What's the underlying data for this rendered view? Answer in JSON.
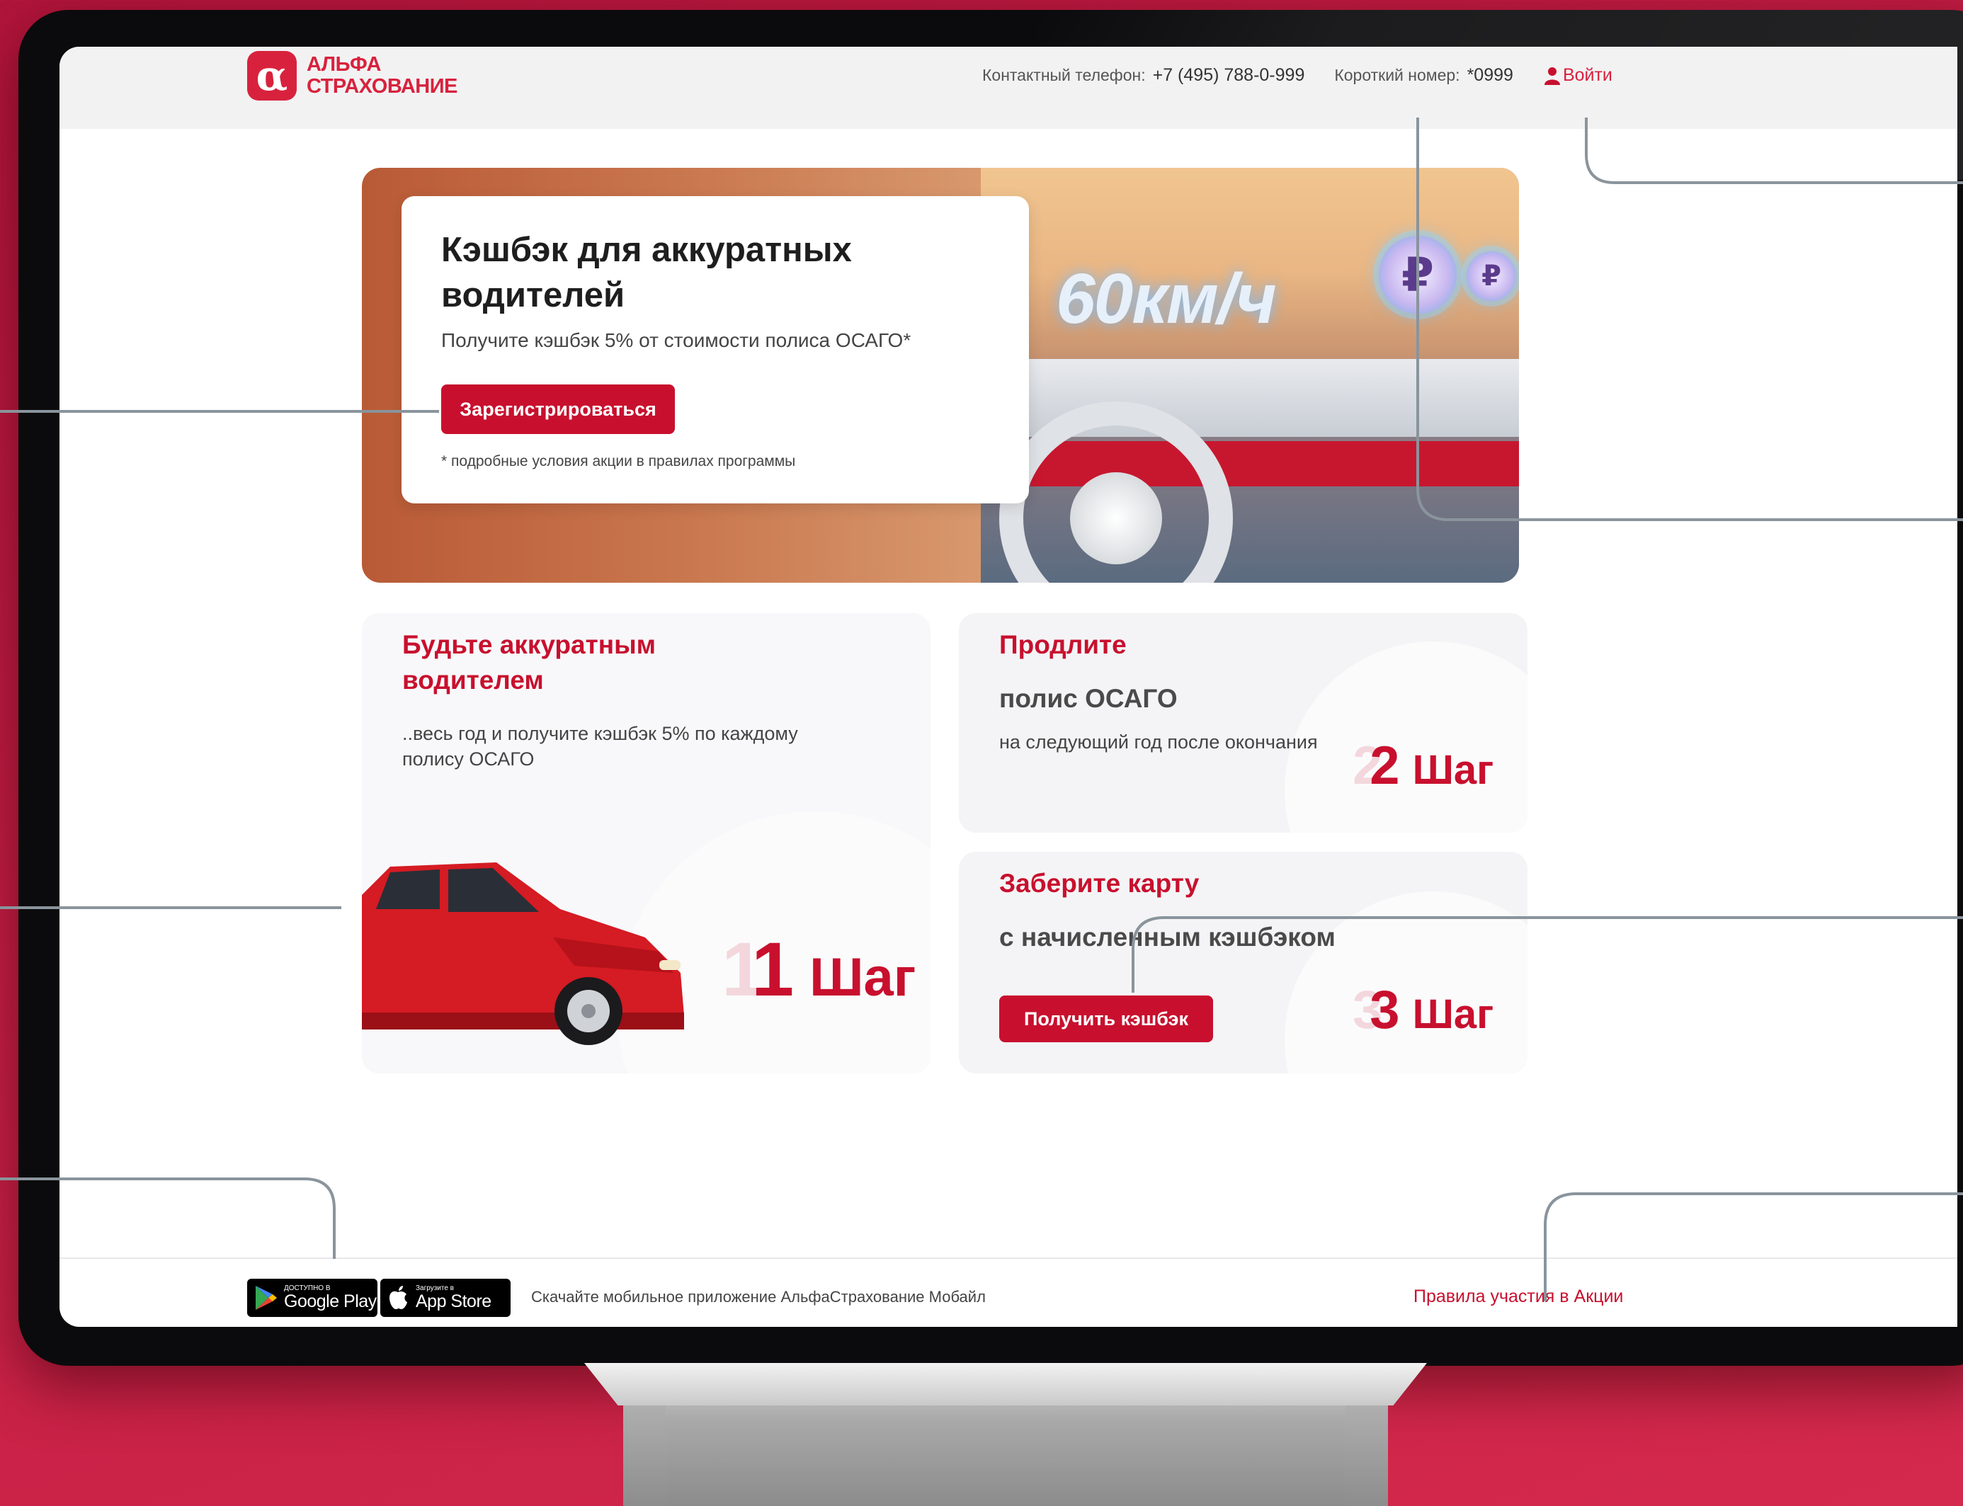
{
  "brand": {
    "name_line1": "АЛЬФА",
    "name_line2": "СТРАХОВАНИЕ",
    "logo_symbol": "α",
    "accent_color": "#c8102e"
  },
  "header": {
    "phone_label": "Контактный телефон:",
    "phone_value": "+7 (495) 788-0-999",
    "short_label": "Короткий номер:",
    "short_value": "*0999",
    "login_label": "Войти",
    "login_icon": "user-icon"
  },
  "hero": {
    "title": "Кэшбэк для аккуратных водителей",
    "subtitle": "Получите кэшбэк 5% от стоимости полиса ОСАГО*",
    "register_button": "Зарегистрироваться",
    "note": "* подробные условия акции в правилах программы",
    "speed_text": "60км/ч",
    "coin_symbol": "₽"
  },
  "steps": [
    {
      "title": "Будьте аккуратным водителем",
      "text": "..весь год и получите кэшбэк 5% по каждому полису ОСАГО",
      "number": "1",
      "word": "Шаг"
    },
    {
      "title": "Продлите",
      "subtitle": "полис ОСАГО",
      "text": "на следующий год после окончания",
      "number": "2",
      "word": "Шаг"
    },
    {
      "title": "Заберите карту",
      "subtitle": "с начисленным кэшбэком",
      "button": "Получить кэшбэк",
      "number": "3",
      "word": "Шаг"
    }
  ],
  "footer": {
    "google_play_small": "ДОСТУПНО В",
    "google_play_big": "Google Play",
    "app_store_small": "Загрузите в",
    "app_store_big": "App Store",
    "download_text": "Скачайте мобильное приложение АльфаСтрахование Мобайл",
    "rules_link": "Правила участия в Акции"
  }
}
